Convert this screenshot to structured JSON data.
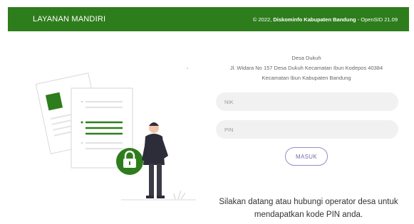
{
  "header": {
    "brand": "LAYANAN MANDIRI",
    "copyright_prefix": "© 2022,",
    "copyright_org": "Diskominfo Kabupaten Bandung",
    "copyright_suffix": "- OpenSID 21.09"
  },
  "village": {
    "name": "Desa Dukuh",
    "address": "Jl. Widara No 157 Desa Dukuh Kecamatan Ibun Kodepos 40384",
    "region": "Kecamatan Ibun Kabupaten Bandung"
  },
  "form": {
    "nik_placeholder": "NIK",
    "pin_placeholder": "PIN",
    "submit_label": "MASUK"
  },
  "notice": "Silakan datang atau hubungi operator desa untuk mendapatkan kode PIN anda.",
  "illustration": {
    "icon": "lock-icon",
    "accent": "#2e7d1c"
  },
  "colors": {
    "brand": "#2e7d1c",
    "field_bg": "#f1f1f1",
    "button_border": "#9b8ac4"
  }
}
